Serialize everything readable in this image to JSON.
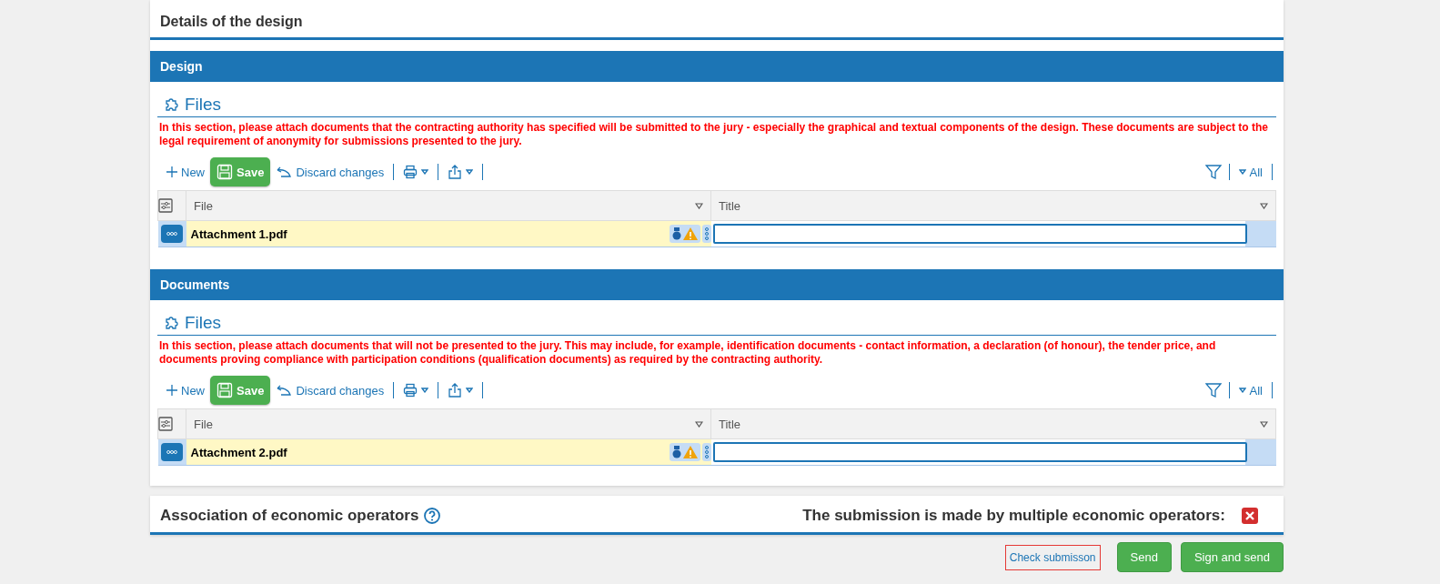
{
  "page_title": "Details of the design",
  "sections": [
    {
      "title": "Design",
      "heading": "Files",
      "note": "In this section, please attach documents that the contracting authority has specified will be submitted to the jury - especially the graphical and textual components of the design. These documents are subject to the legal requirement of anonymity for submissions presented to the jury.",
      "toolbar": {
        "new": "New",
        "save": "Save",
        "discard": "Discard changes",
        "all": "All"
      },
      "columns": [
        "File",
        "Title"
      ],
      "rows": [
        {
          "file": "Attachment 1.pdf"
        }
      ]
    },
    {
      "title": "Documents",
      "heading": "Files",
      "note": "In this section, please attach documents that will not be presented to the jury. This may include, for example, identification documents - contact information, a declaration (of honour), the tender price, and documents proving compliance with participation conditions (qualification documents) as required by the contracting authority.",
      "toolbar": {
        "new": "New",
        "save": "Save",
        "discard": "Discard changes",
        "all": "All"
      },
      "columns": [
        "File",
        "Title"
      ],
      "rows": [
        {
          "file": "Attachment 2.pdf"
        }
      ]
    }
  ],
  "association": {
    "title": "Association of economic operators",
    "multiple_label": "The submission is made by multiple economic operators:",
    "multiple_operators": false
  },
  "buttons": [
    {
      "label": "Check submisson",
      "kind": "link"
    },
    {
      "label": "Send",
      "kind": "primary"
    },
    {
      "label": "Sign and send",
      "kind": "primary"
    }
  ]
}
